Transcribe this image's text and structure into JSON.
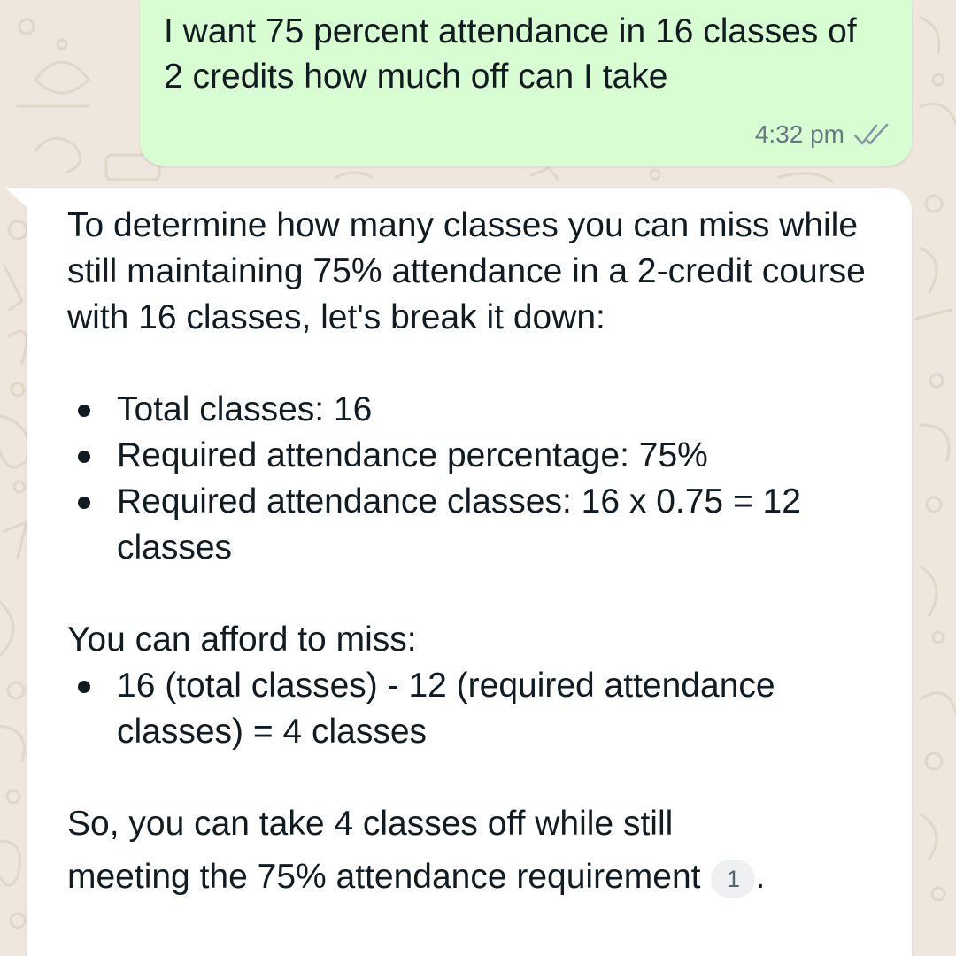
{
  "chat": {
    "sent_message": {
      "text": "I want 75 percent attendance in 16 classes of 2 credits how much off can I take",
      "time": "4:32 pm",
      "status_icon": "double-check-icon"
    },
    "reply": {
      "intro": "To determine how many classes you can miss while still maintaining 75% attendance in a 2-credit course with 16 classes, let's break it down:",
      "bullets": [
        "Total classes: 16",
        "Required attendance percentage: 75%",
        "Required attendance classes: 16 x 0.75 = 12 classes"
      ],
      "afford_heading": "You can afford to miss:",
      "afford_bullets": [
        "16 (total classes) - 12 (required attendance classes) = 4 classes"
      ],
      "conclusion_line1": "So, you can take 4 classes off while still",
      "conclusion_line2": "meeting the 75% attendance requirement",
      "citation": "1",
      "end_punct": "."
    }
  },
  "colors": {
    "wallpaper": "#efe7dd",
    "sent_bubble": "#d9fdd3",
    "received_bubble": "#ffffff",
    "text": "#111b21",
    "meta_text": "#667781"
  }
}
